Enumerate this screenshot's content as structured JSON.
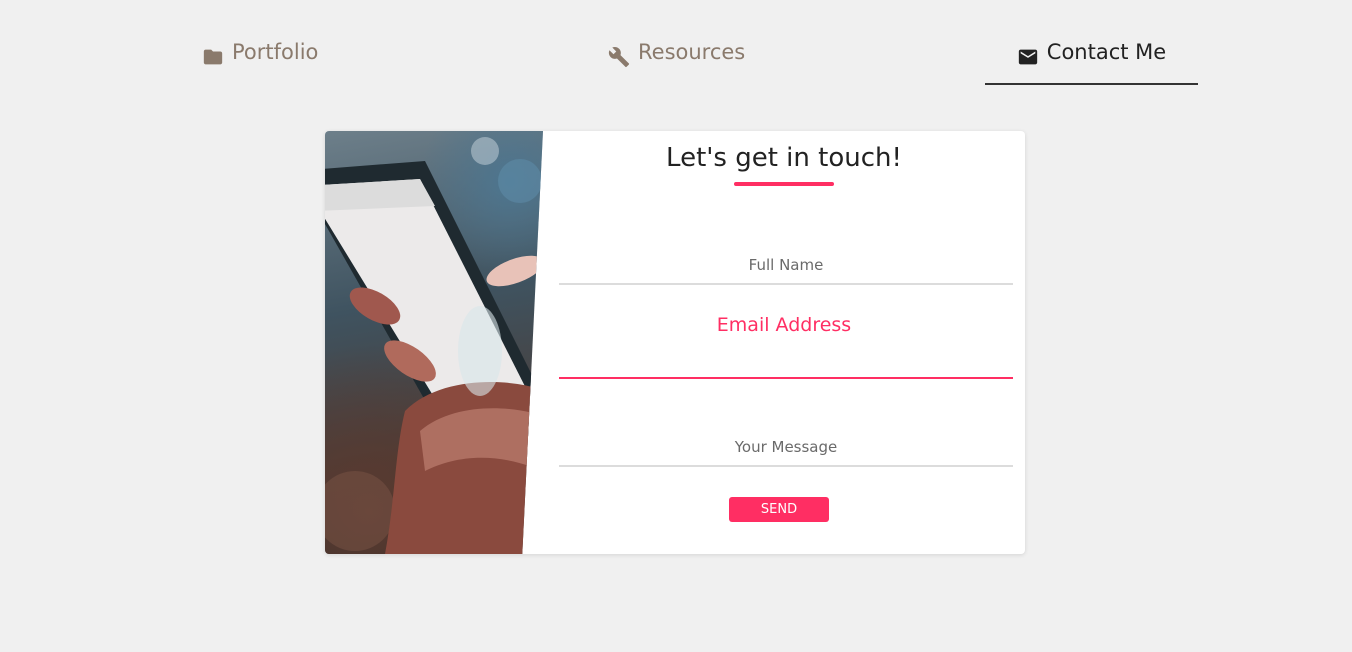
{
  "nav": {
    "items": [
      {
        "label": "Portfolio",
        "icon": "folder-icon"
      },
      {
        "label": "Resources",
        "icon": "wrench-icon"
      },
      {
        "label": "Contact Me",
        "icon": "envelope-icon",
        "active": true
      }
    ]
  },
  "contact": {
    "title": "Let's get in touch!",
    "full_name_placeholder": "Full Name",
    "email_label": "Email Address",
    "email_value": "",
    "message_placeholder": "Your Message",
    "send_label": "SEND"
  },
  "colors": {
    "accent": "#ff2e63",
    "background": "#f0f0f0",
    "nav_text": "#8a7a6c",
    "nav_active": "#222222"
  }
}
